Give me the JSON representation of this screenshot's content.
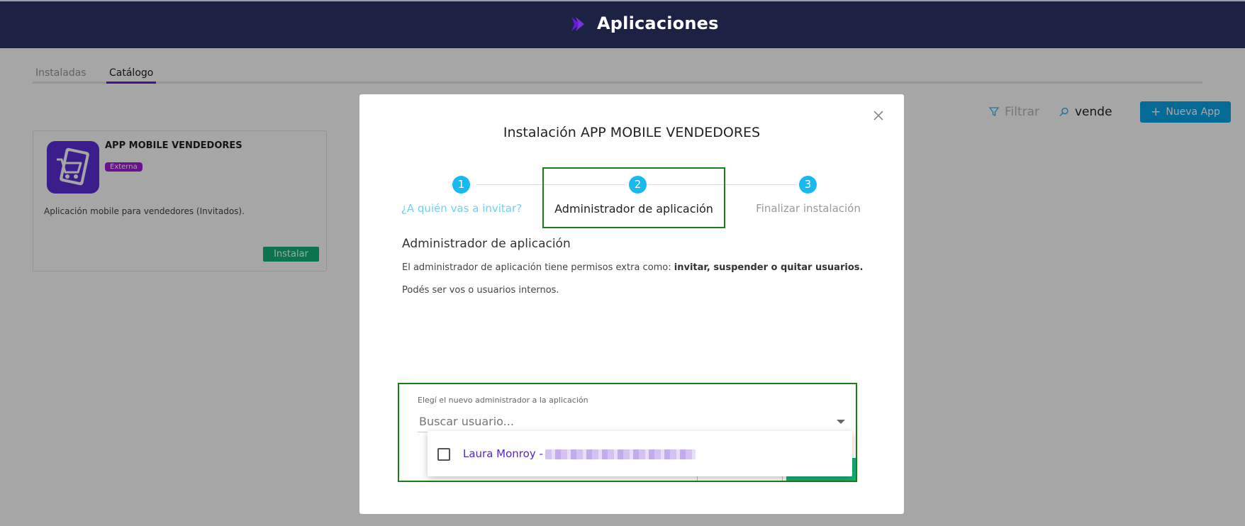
{
  "header": {
    "title": "Aplicaciones"
  },
  "tabs": [
    {
      "label": "Instaladas"
    },
    {
      "label": "Catálogo"
    }
  ],
  "toolbar": {
    "filter_label": "Filtrar",
    "search_value": "vende",
    "new_app_label": "Nueva App"
  },
  "card": {
    "name": "APP MOBILE VENDEDORES",
    "badge": "Externa",
    "description": "Aplicación mobile para vendedores (Invitados).",
    "install_label": "Instalar"
  },
  "modal": {
    "title": "Instalación APP MOBILE VENDEDORES",
    "steps": [
      {
        "number": "1",
        "label": "¿A quién vas a invitar?"
      },
      {
        "number": "2",
        "label": "Administrador de aplicación"
      },
      {
        "number": "3",
        "label": "Finalizar instalación"
      }
    ],
    "section_title": "Administrador de aplicación",
    "line1_prefix": "El administrador de aplicación tiene permisos extra como: ",
    "line1_bold": "invitar, suspender o quitar usuarios.",
    "line2": "Podés ser vos o usuarios internos.",
    "select_label": "Elegí el nuevo administrador a la aplicación",
    "select_placeholder": "Buscar usuario...",
    "option_name": "Laura Monroy - "
  },
  "colors": {
    "accent": "#0aa4e8",
    "brand": "#6a1bd9",
    "header_bg": "#1d2244",
    "success": "#14b179"
  }
}
